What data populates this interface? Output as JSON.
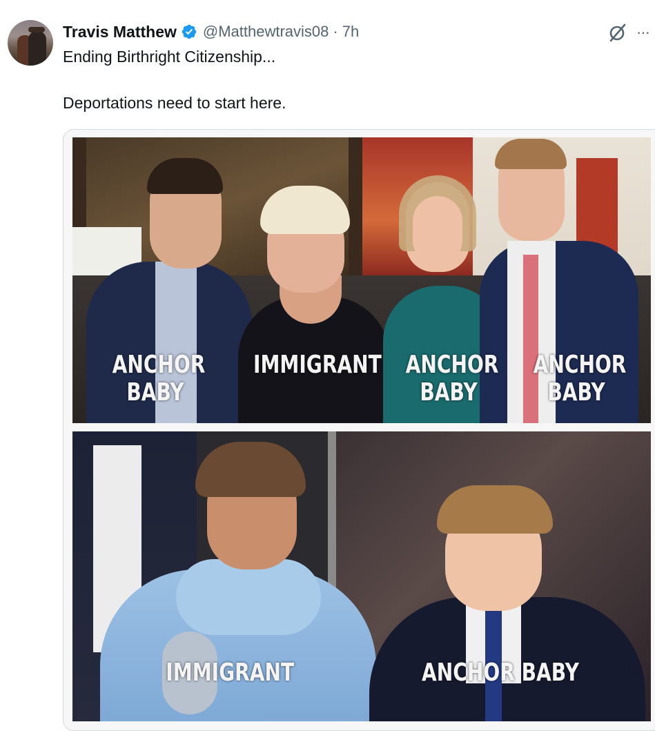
{
  "tweet": {
    "display_name": "Travis Matthew",
    "handle": "@Matthewtravis08",
    "separator": "·",
    "time": "7h",
    "text_line1": "Ending Birthright Citizenship...",
    "text_line2": "Deportations need to start here.",
    "more_label": "···"
  },
  "icons": {
    "verified": "verified-badge-icon",
    "grok": "grok-icon",
    "more": "more-options-icon"
  },
  "colors": {
    "verified_blue": "#1d9bf0",
    "text": "#0f1419",
    "muted": "#536471",
    "border": "#cfd9de"
  },
  "media": {
    "top_labels": [
      {
        "line1": "ANCHOR",
        "line2": "BABY"
      },
      {
        "line1": "IMMIGRANT",
        "line2": ""
      },
      {
        "line1": "ANCHOR",
        "line2": "BABY"
      },
      {
        "line1": "ANCHOR",
        "line2": "BABY"
      }
    ],
    "bottom_labels": [
      "IMMIGRANT",
      "ANCHOR BABY"
    ]
  }
}
